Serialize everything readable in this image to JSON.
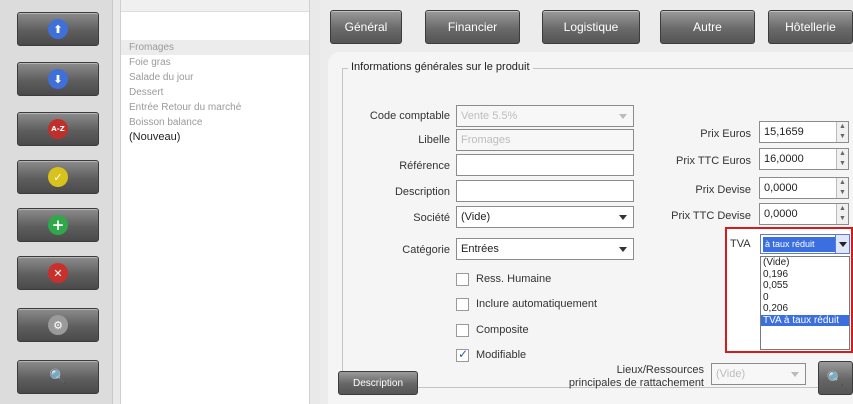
{
  "toolbar": {
    "buttons": [
      {
        "name": "nav-up",
        "icon": "arrow-up-icon",
        "glyph": "⬆",
        "color": "#3f6fd8"
      },
      {
        "name": "nav-down",
        "icon": "arrow-down-icon",
        "glyph": "⬇",
        "color": "#3f6fd8"
      },
      {
        "name": "sort-az",
        "icon": "sort-az-icon",
        "glyph": "A-Z",
        "color": "#c0302b"
      },
      {
        "name": "validate",
        "icon": "check-icon",
        "glyph": "✓",
        "color": "#d8c21c"
      },
      {
        "name": "add",
        "icon": "plus-icon",
        "glyph": "+",
        "color": "#2fa84a"
      },
      {
        "name": "delete",
        "icon": "x-circle-icon",
        "glyph": "✕",
        "color": "#c9302c"
      },
      {
        "name": "settings",
        "icon": "wheel-icon",
        "glyph": "⚙",
        "color": "#9a9a9a"
      },
      {
        "name": "search",
        "icon": "magnifier-icon",
        "glyph": "🔍",
        "color": "#6a8fc9"
      }
    ]
  },
  "list": {
    "items": [
      {
        "label": "Fromages"
      },
      {
        "label": "Foie gras"
      },
      {
        "label": "Salade du jour"
      },
      {
        "label": "Dessert"
      },
      {
        "label": "Entrée Retour du marché"
      },
      {
        "label": "Boisson balance"
      },
      {
        "label": "(Nouveau)"
      }
    ]
  },
  "tabs": [
    "Général",
    "Financier",
    "Logistique",
    "Autre",
    "Hôtellerie"
  ],
  "form": {
    "group_title": "Informations générales sur le produit",
    "code_comptable_label": "Code comptable",
    "code_comptable_value": "Vente 5.5%",
    "libelle_label": "Libelle",
    "libelle_value": "Fromages",
    "reference_label": "Référence",
    "reference_value": "",
    "description_label": "Description",
    "description_value": "",
    "societe_label": "Société",
    "societe_value": "(Vide)",
    "categorie_label": "Catégorie",
    "categorie_value": "Entrées",
    "prix_euros_label": "Prix Euros",
    "prix_euros_value": "15,1659",
    "prix_ttc_euros_label": "Prix TTC Euros",
    "prix_ttc_euros_value": "16,0000",
    "prix_devise_label": "Prix Devise",
    "prix_devise_value": "0,0000",
    "prix_ttc_devise_label": "Prix TTC Devise",
    "prix_ttc_devise_value": "0,0000",
    "tva_label": "TVA",
    "tva_value": "à taux réduit",
    "tva_options": [
      "(Vide)",
      "0,196",
      "0,055",
      "0",
      "0,206",
      "TVA à taux réduit"
    ],
    "checkboxes": [
      {
        "label": "Ress. Humaine",
        "checked": false
      },
      {
        "label": "Inclure automatiquement",
        "checked": false
      },
      {
        "label": "Composite",
        "checked": false
      },
      {
        "label": "Modifiable",
        "checked": true
      }
    ],
    "description_button": "Description",
    "lieux_label_1": "Lieux/Ressources",
    "lieux_label_2": "principales de rattachement",
    "lieux_value": "(Vide)"
  }
}
